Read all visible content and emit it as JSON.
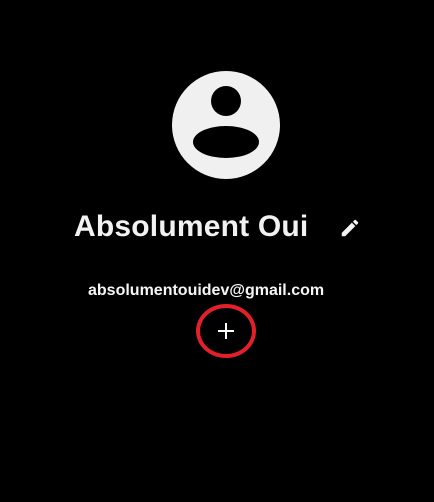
{
  "profile": {
    "display_name": "Absolument Oui",
    "email": "absolumentouidev@gmail.com"
  },
  "icons": {
    "avatar": "account-circle-icon",
    "edit": "pencil-icon",
    "add": "plus-icon"
  },
  "colors": {
    "background": "#000000",
    "text": "#ffffff",
    "avatar_fill": "#f0f0f0",
    "highlight_ring": "#e3202a"
  }
}
